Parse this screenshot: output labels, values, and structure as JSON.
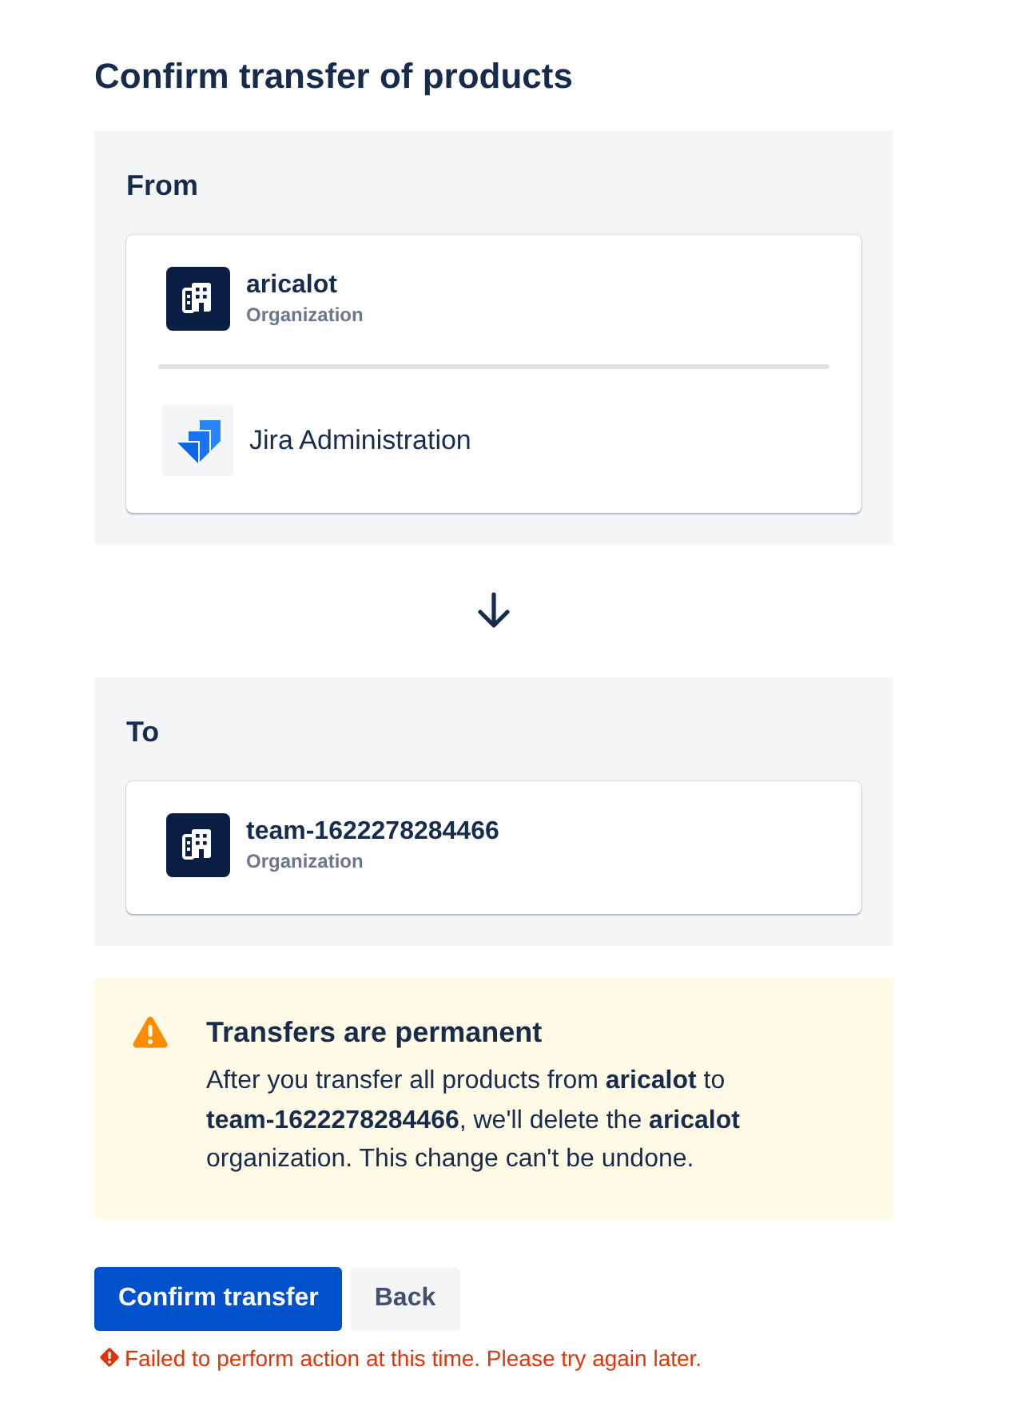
{
  "title": "Confirm transfer of products",
  "from": {
    "heading": "From",
    "organization": {
      "name": "aricalot",
      "type": "Organization"
    },
    "products": [
      {
        "name": "Jira Administration"
      }
    ]
  },
  "to": {
    "heading": "To",
    "organization": {
      "name": "team-1622278284466",
      "type": "Organization"
    }
  },
  "warning": {
    "title": "Transfers are permanent",
    "message": "After you transfer all products from **aricalot** to **team-1622278284466**, we'll delete the **aricalot** organization. This change can't be undone."
  },
  "buttons": [
    {
      "label": "Confirm transfer",
      "kind": "primary"
    },
    {
      "label": "Back",
      "kind": "subtle"
    }
  ],
  "error": "Failed to perform action at this time. Please try again later."
}
